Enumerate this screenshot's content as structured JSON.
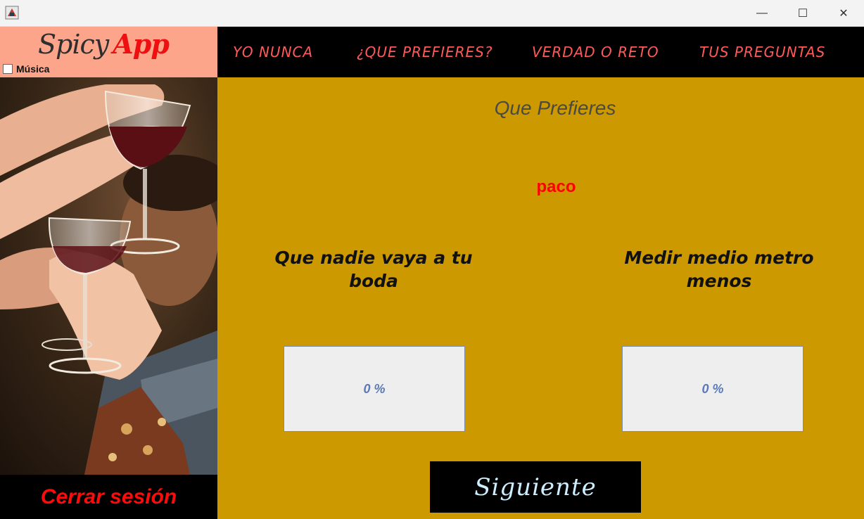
{
  "window": {
    "minimize_glyph": "—",
    "maximize_glyph": "☐",
    "close_glyph": "✕"
  },
  "sidebar": {
    "logo_part1": "Spicy",
    "logo_part2": "App",
    "music_label": "Música",
    "music_checked": false,
    "logout_label": "Cerrar sesión"
  },
  "nav": {
    "items": [
      {
        "label": "YO NUNCA"
      },
      {
        "label": "¿QUE PREFIERES?"
      },
      {
        "label": "VERDAD O RETO"
      },
      {
        "label": "TUS PREGUNTAS"
      }
    ]
  },
  "main": {
    "title": "Que Prefieres",
    "player": "paco",
    "option1": "Que nadie vaya a tu boda",
    "option2": "Medir medio metro menos",
    "option1_percent": "0 %",
    "option2_percent": "0 %",
    "next_label": "Siguiente"
  },
  "colors": {
    "logo_bg": "#fca58b",
    "main_bg": "#cc9900",
    "nav_text": "#ff5a5a",
    "accent_red": "#ff0000"
  }
}
